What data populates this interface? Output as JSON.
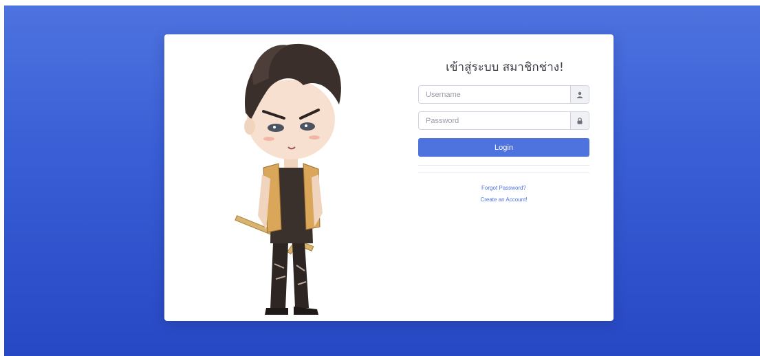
{
  "login": {
    "title": "เข้าสู่ระบบ สมาชิกช่าง!",
    "username_placeholder": "Username",
    "password_placeholder": "Password",
    "login_label": "Login",
    "forgot_label": "Forgot Password?",
    "create_label": "Create an Account!"
  },
  "icons": {
    "username": "user-icon",
    "password": "lock-icon"
  },
  "colors": {
    "primary": "#4e73df",
    "background_top": "#4e73df",
    "background_bottom": "#2748c4"
  }
}
